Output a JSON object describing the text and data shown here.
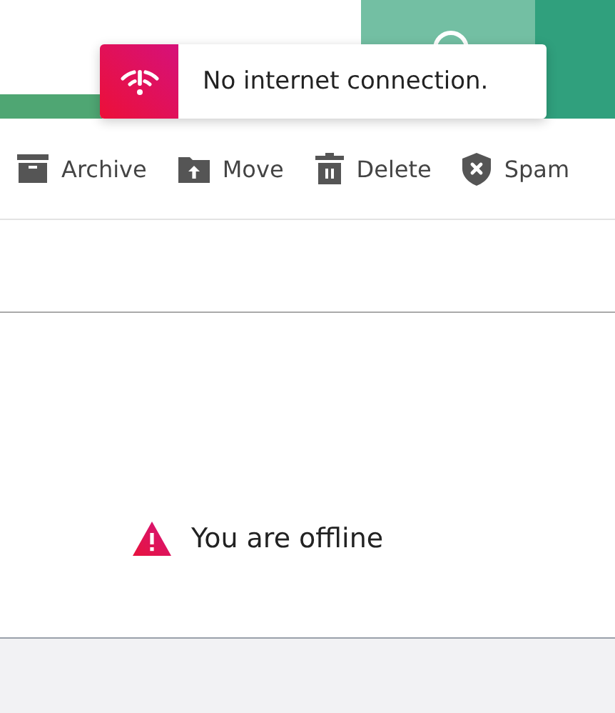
{
  "toast": {
    "message": "No internet connection."
  },
  "toolbar": [
    {
      "kind": "archive",
      "label": "Archive"
    },
    {
      "kind": "move",
      "label": "Move"
    },
    {
      "kind": "delete",
      "label": "Delete"
    },
    {
      "kind": "spam",
      "label": "Spam"
    }
  ],
  "content": {
    "status": "You are offline"
  }
}
